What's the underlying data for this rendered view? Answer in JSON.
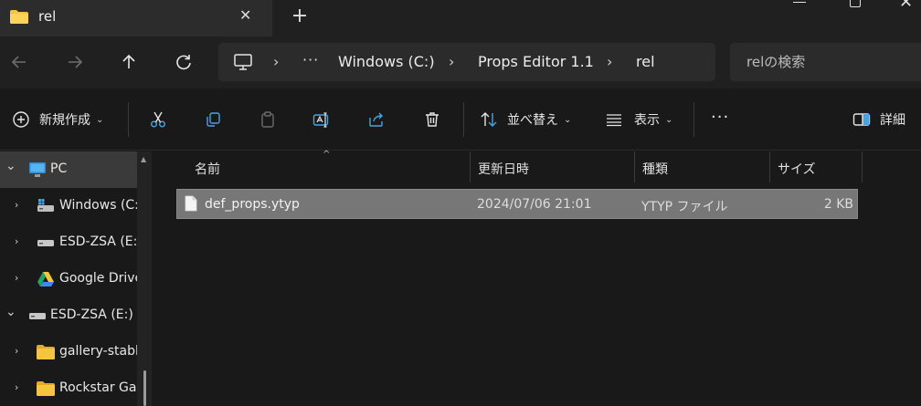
{
  "window": {
    "tab_title": "rel",
    "close_tab_glyph": "✕",
    "new_tab_glyph": "+",
    "close_glyph": "✕"
  },
  "nav": {
    "breadcrumbs": [
      "Windows (C:)",
      "Props Editor 1.1",
      "rel"
    ],
    "overflow": "···",
    "separator": "›",
    "search_placeholder": "relの検索"
  },
  "toolbar": {
    "new_label": "新規作成",
    "sort_label": "並べ替え",
    "view_label": "表示",
    "more_label": "···",
    "details_label": "詳細"
  },
  "sidebar": {
    "items": [
      {
        "label": "PC",
        "expander": "⌄"
      },
      {
        "label": "Windows (C:)",
        "expander": "›"
      },
      {
        "label": "ESD-ZSA (E:)",
        "expander": "›"
      },
      {
        "label": "Google Drive",
        "expander": "›"
      },
      {
        "label": "ESD-ZSA (E:)",
        "expander": "⌄"
      },
      {
        "label": "gallery-stable",
        "expander": "›"
      },
      {
        "label": "Rockstar Games",
        "expander": "›"
      }
    ]
  },
  "columns": {
    "name": "名前",
    "modified": "更新日時",
    "type": "種類",
    "size": "サイズ"
  },
  "files": [
    {
      "name": "def_props.ytyp",
      "modified": "2024/07/06 21:01",
      "type": "YTYP ファイル",
      "size": "2 KB"
    }
  ],
  "colors": {
    "folder_yellow": "#f5c542",
    "selected_row": "#777777",
    "accent_blue": "#4aa3df"
  }
}
